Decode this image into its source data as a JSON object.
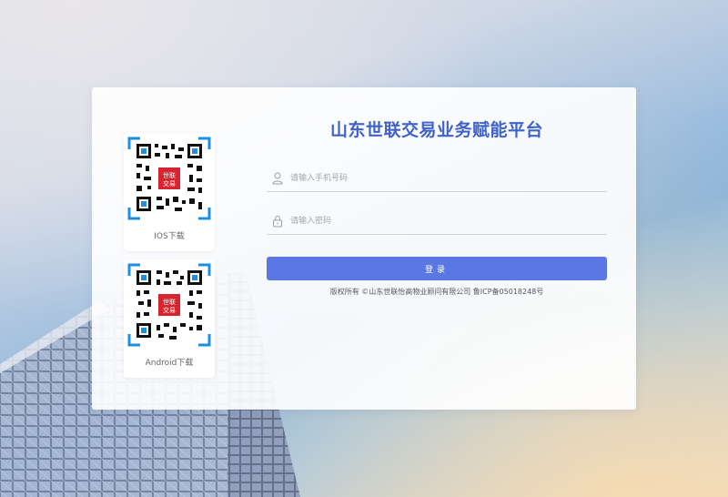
{
  "app_title": "山东世联交易业务赋能平台",
  "qr_codes": [
    {
      "label": "IOS下载",
      "logo_text": "世联 交易"
    },
    {
      "label": "Android下载",
      "logo_text": "世联 交易"
    }
  ],
  "form": {
    "phone_placeholder": "请输入手机号码",
    "phone_value": "",
    "password_placeholder": "请输入密码",
    "password_value": "",
    "login_label": "登录"
  },
  "footer": {
    "copyright": "版权所有 ©山东世联怡高物业顾问有限公司 鲁ICP备05018248号"
  },
  "colors": {
    "accent": "#5a77e4",
    "title": "#3f62c9",
    "qr_frame": "#1e8fe0",
    "qr_logo": "#d9232e"
  },
  "icons": [
    "user-icon",
    "lock-icon",
    "qr-code-icon"
  ]
}
